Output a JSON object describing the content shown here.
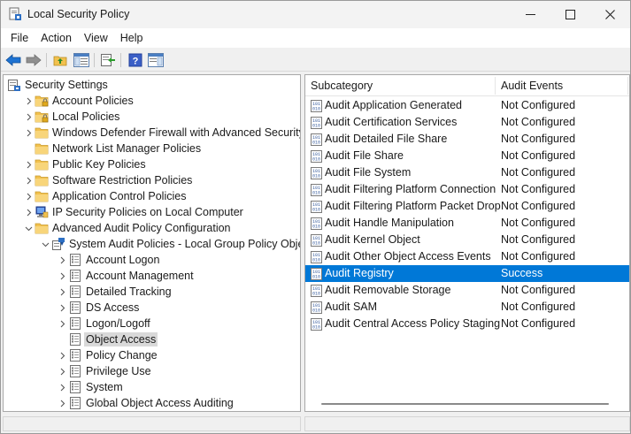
{
  "window": {
    "title": "Local Security Policy",
    "controls": {
      "minimize": "—",
      "maximize": "☐",
      "close": "✕"
    }
  },
  "menu": [
    "File",
    "Action",
    "View",
    "Help"
  ],
  "tree": [
    {
      "label": "Security Settings",
      "depth": 0,
      "expander": "none",
      "icon": "security-settings-icon"
    },
    {
      "label": "Account Policies",
      "depth": 1,
      "expander": "collapsed",
      "icon": "folder-lock-icon"
    },
    {
      "label": "Local Policies",
      "depth": 1,
      "expander": "collapsed",
      "icon": "folder-lock-icon"
    },
    {
      "label": "Windows Defender Firewall with Advanced Security",
      "depth": 1,
      "expander": "collapsed",
      "icon": "folder-icon"
    },
    {
      "label": "Network List Manager Policies",
      "depth": 1,
      "expander": "none",
      "icon": "folder-icon"
    },
    {
      "label": "Public Key Policies",
      "depth": 1,
      "expander": "collapsed",
      "icon": "folder-icon"
    },
    {
      "label": "Software Restriction Policies",
      "depth": 1,
      "expander": "collapsed",
      "icon": "folder-icon"
    },
    {
      "label": "Application Control Policies",
      "depth": 1,
      "expander": "collapsed",
      "icon": "folder-icon"
    },
    {
      "label": "IP Security Policies on Local Computer",
      "depth": 1,
      "expander": "collapsed",
      "icon": "ipsec-icon"
    },
    {
      "label": "Advanced Audit Policy Configuration",
      "depth": 1,
      "expander": "expanded",
      "icon": "folder-icon"
    },
    {
      "label": "System Audit Policies - Local Group Policy Object",
      "depth": 2,
      "expander": "expanded",
      "icon": "audit-policy-icon"
    },
    {
      "label": "Account Logon",
      "depth": 3,
      "expander": "collapsed",
      "icon": "policy-doc-icon"
    },
    {
      "label": "Account Management",
      "depth": 3,
      "expander": "collapsed",
      "icon": "policy-doc-icon"
    },
    {
      "label": "Detailed Tracking",
      "depth": 3,
      "expander": "collapsed",
      "icon": "policy-doc-icon"
    },
    {
      "label": "DS Access",
      "depth": 3,
      "expander": "collapsed",
      "icon": "policy-doc-icon"
    },
    {
      "label": "Logon/Logoff",
      "depth": 3,
      "expander": "collapsed",
      "icon": "policy-doc-icon"
    },
    {
      "label": "Object Access",
      "depth": 3,
      "expander": "none",
      "icon": "policy-doc-icon",
      "selected": true
    },
    {
      "label": "Policy Change",
      "depth": 3,
      "expander": "collapsed",
      "icon": "policy-doc-icon"
    },
    {
      "label": "Privilege Use",
      "depth": 3,
      "expander": "collapsed",
      "icon": "policy-doc-icon"
    },
    {
      "label": "System",
      "depth": 3,
      "expander": "collapsed",
      "icon": "policy-doc-icon"
    },
    {
      "label": "Global Object Access Auditing",
      "depth": 3,
      "expander": "collapsed",
      "icon": "policy-doc-icon"
    }
  ],
  "list": {
    "columns": [
      "Subcategory",
      "Audit Events"
    ],
    "rows": [
      {
        "subcategory": "Audit Application Generated",
        "events": "Not Configured"
      },
      {
        "subcategory": "Audit Certification Services",
        "events": "Not Configured"
      },
      {
        "subcategory": "Audit Detailed File Share",
        "events": "Not Configured"
      },
      {
        "subcategory": "Audit File Share",
        "events": "Not Configured"
      },
      {
        "subcategory": "Audit File System",
        "events": "Not Configured"
      },
      {
        "subcategory": "Audit Filtering Platform Connection",
        "events": "Not Configured"
      },
      {
        "subcategory": "Audit Filtering Platform Packet Drop",
        "events": "Not Configured"
      },
      {
        "subcategory": "Audit Handle Manipulation",
        "events": "Not Configured"
      },
      {
        "subcategory": "Audit Kernel Object",
        "events": "Not Configured"
      },
      {
        "subcategory": "Audit Other Object Access Events",
        "events": "Not Configured"
      },
      {
        "subcategory": "Audit Registry",
        "events": "Success",
        "selected": true
      },
      {
        "subcategory": "Audit Removable Storage",
        "events": "Not Configured"
      },
      {
        "subcategory": "Audit SAM",
        "events": "Not Configured"
      },
      {
        "subcategory": "Audit Central Access Policy Staging",
        "events": "Not Configured"
      }
    ]
  },
  "colors": {
    "selection": "#0078d7",
    "tree_selection": "#d9d9d9",
    "folder": "#f2c14e",
    "toolbar_blue": "#1e73d2"
  }
}
